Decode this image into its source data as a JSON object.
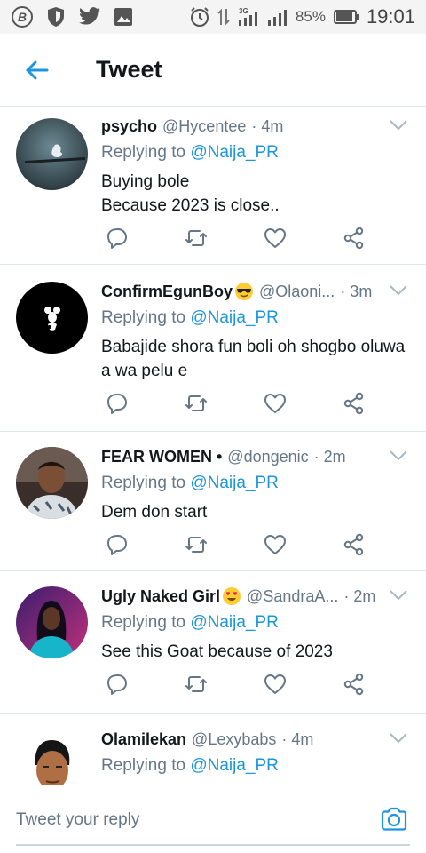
{
  "status_bar": {
    "battery_percent": "85%",
    "time": "19:01",
    "network": "3G",
    "left_icons": [
      "b-notification-icon",
      "shield-icon",
      "twitter-bird-icon",
      "gallery-icon"
    ],
    "right_icons": [
      "alarm-icon",
      "data-arrows-icon",
      "signal-3g-icon",
      "signal-icon",
      "battery-icon"
    ]
  },
  "header": {
    "title": "Tweet"
  },
  "tweets": [
    {
      "name": "psycho",
      "emoji": "",
      "handle": "@Hycentee",
      "time": "· 4m",
      "replying_prefix": "Replying to ",
      "replying_to": "@Naija_PR",
      "text_lines": [
        "Buying bole",
        "Because 2023 is close.."
      ]
    },
    {
      "name": "ConfirmEgunBoy",
      "emoji": "sunglasses-emoji",
      "handle": "@Olaoni...",
      "time": "· 3m",
      "replying_prefix": "Replying to ",
      "replying_to": "@Naija_PR",
      "text_lines": [
        "Babajide shora fun boli oh shogbo oluwa",
        "a wa pelu e"
      ]
    },
    {
      "name": "FEAR WOMEN •",
      "emoji": "",
      "handle": "@dongenic",
      "time": "· 2m",
      "replying_prefix": "Replying to ",
      "replying_to": "@Naija_PR",
      "text_lines": [
        "Dem don start"
      ]
    },
    {
      "name": "Ugly Naked Girl",
      "emoji": "heart-eyes-emoji",
      "handle": "@SandraA...",
      "time": "· 2m",
      "replying_prefix": "Replying to ",
      "replying_to": "@Naija_PR",
      "text_lines": [
        "See this Goat because of 2023"
      ]
    },
    {
      "name": "Olamilekan",
      "emoji": "",
      "handle": "@Lexybabs",
      "time": "· 4m",
      "replying_prefix": "Replying to ",
      "replying_to": "@Naija_PR",
      "text_lines": []
    }
  ],
  "composer": {
    "placeholder": "Tweet your reply"
  },
  "colors": {
    "accent": "#1b95e0",
    "secondary_text": "#657786",
    "divider": "#e1e8ed"
  }
}
